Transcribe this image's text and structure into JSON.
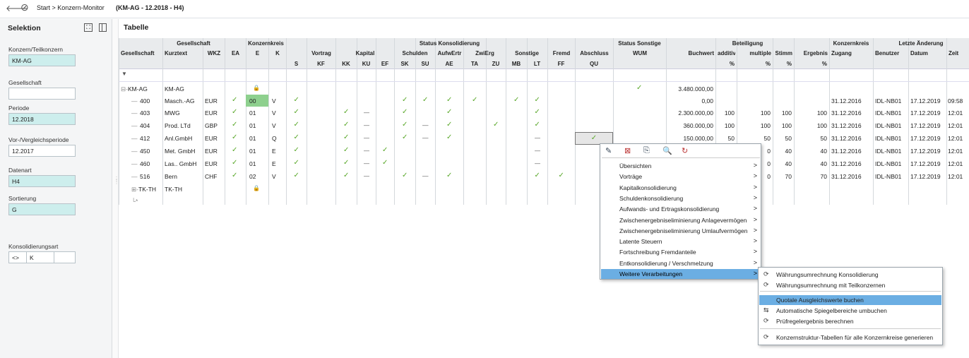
{
  "topbar": {
    "back_icon": "arrow-left-icon",
    "cancel_icon": "no-entry-icon",
    "breadcrumb": "Start > Konzern-Monitor",
    "context": "(KM-AG - 12.2018 - H4)"
  },
  "sidebar": {
    "title": "Selektion",
    "fields": [
      {
        "label": "Konzern/Teilkonzern",
        "value": "KM-AG",
        "teal": true
      },
      {
        "label": "Gesellschaft",
        "value": "",
        "teal": false
      },
      {
        "label": "Periode",
        "value": "12.2018",
        "teal": true
      },
      {
        "label": "Vor-/Vergleichsperiode",
        "value": "12.2017",
        "teal": false
      },
      {
        "label": "Datenart",
        "value": "H4",
        "teal": true
      },
      {
        "label": "Sortierung",
        "value": "G",
        "teal": true
      }
    ],
    "konsart_label": "Konsolidierungsart",
    "konsart_op": "<>",
    "konsart_value": "K"
  },
  "main": {
    "title": "Tabelle"
  },
  "table": {
    "group_headers": [
      "Gesellschaft",
      "Konzernkreis",
      "Status Konsolidierung",
      "Status Sonstige",
      "Beteiligung",
      "Konzernkreis",
      "Letzte Änderung"
    ],
    "row1": [
      "Gesellschaft",
      "Kurztext",
      "WKZ",
      "EA",
      "E",
      "K",
      "Vortrag",
      "Kapital",
      "Schulden",
      "AufwErtr",
      "ZwiErg",
      "Sonstige",
      "Fremd",
      "Abschluss",
      "WUM",
      "Buchwert",
      "additiv",
      "multiple",
      "Stimm",
      "Ergebnis",
      "Zugang",
      "Benutzer",
      "Datum",
      "Zeit"
    ],
    "row2": [
      "S",
      "KF",
      "KK",
      "KU",
      "EF",
      "SK",
      "SU",
      "AE",
      "TA",
      "ZU",
      "MB",
      "LT",
      "FF",
      "QU",
      "%",
      "%",
      "%",
      "%"
    ],
    "rows": [
      {
        "ges": "KM-AG",
        "kurz": "KM-AG",
        "wkz": "",
        "ea": "",
        "e": "",
        "k": "",
        "buchwert": "3.480.000,00",
        "additiv": "",
        "multiple": "",
        "stimm": "",
        "ergebnis": "",
        "zugang": "",
        "benutzer": "",
        "datum": "",
        "zeit": ""
      },
      {
        "ges": "400",
        "kurz": "Masch.-AG",
        "wkz": "EUR",
        "ea": "✓",
        "e": "00",
        "k": "V",
        "buchwert": "0,00",
        "additiv": "",
        "multiple": "",
        "stimm": "",
        "ergebnis": "",
        "zugang": "31.12.2016",
        "benutzer": "IDL-NB01",
        "datum": "17.12.2019",
        "zeit": "09:58"
      },
      {
        "ges": "403",
        "kurz": "MWG",
        "wkz": "EUR",
        "ea": "✓",
        "e": "01",
        "k": "V",
        "buchwert": "2.300.000,00",
        "additiv": "100",
        "multiple": "100",
        "stimm": "100",
        "ergebnis": "100",
        "zugang": "31.12.2016",
        "benutzer": "IDL-NB01",
        "datum": "17.12.2019",
        "zeit": "12:01"
      },
      {
        "ges": "404",
        "kurz": "Prod. LTd",
        "wkz": "GBP",
        "ea": "✓",
        "e": "01",
        "k": "V",
        "buchwert": "360.000,00",
        "additiv": "100",
        "multiple": "100",
        "stimm": "100",
        "ergebnis": "100",
        "zugang": "31.12.2016",
        "benutzer": "IDL-NB01",
        "datum": "17.12.2019",
        "zeit": "12:01"
      },
      {
        "ges": "412",
        "kurz": "Anl.GmbH",
        "wkz": "EUR",
        "ea": "✓",
        "e": "01",
        "k": "Q",
        "buchwert": "150.000,00",
        "additiv": "50",
        "multiple": "50",
        "stimm": "50",
        "ergebnis": "50",
        "zugang": "31.12.2016",
        "benutzer": "IDL-NB01",
        "datum": "17.12.2019",
        "zeit": "12:01"
      },
      {
        "ges": "450",
        "kurz": "Met. GmbH",
        "wkz": "EUR",
        "ea": "✓",
        "e": "01",
        "k": "E",
        "buchwert": "",
        "additiv": "",
        "multiple": "0",
        "stimm": "40",
        "ergebnis": "40",
        "zugang": "31.12.2016",
        "benutzer": "IDL-NB01",
        "datum": "17.12.2019",
        "zeit": "12:01"
      },
      {
        "ges": "460",
        "kurz": "Las.. GmbH",
        "wkz": "EUR",
        "ea": "✓",
        "e": "01",
        "k": "E",
        "buchwert": "",
        "additiv": "",
        "multiple": "0",
        "stimm": "40",
        "ergebnis": "40",
        "zugang": "31.12.2016",
        "benutzer": "IDL-NB01",
        "datum": "17.12.2019",
        "zeit": "12:01"
      },
      {
        "ges": "516",
        "kurz": "Bern",
        "wkz": "CHF",
        "ea": "✓",
        "e": "02",
        "k": "V",
        "buchwert": "",
        "additiv": "",
        "multiple": "0",
        "stimm": "70",
        "ergebnis": "70",
        "zugang": "31.12.2016",
        "benutzer": "IDL-NB01",
        "datum": "17.12.2019",
        "zeit": "12:01"
      },
      {
        "ges": "TK-TH",
        "kurz": "TK-TH",
        "wkz": "",
        "ea": "",
        "e": "",
        "k": "",
        "buchwert": "",
        "additiv": "",
        "multiple": "",
        "stimm": "",
        "ergebnis": "",
        "zugang": "",
        "benutzer": "",
        "datum": "",
        "zeit": ""
      }
    ],
    "filter_icon": "filter-icon",
    "lock_icon": "lock-icon",
    "new_row_marker": "*"
  },
  "context_menu": {
    "toolbar_icons": [
      "edit-icon",
      "delete-doc-icon",
      "copy-icon",
      "preview-icon",
      "refresh-icon"
    ],
    "items": [
      "Übersichten",
      "Vorträge",
      "Kapitalkonsolidierung",
      "Schuldenkonsolidierung",
      "Aufwands- und Ertragskonsolidierung",
      "Zwischenergebniseliminierung Anlagevermögen",
      "Zwischenergebniseliminierung Umlaufvermögen",
      "Latente Steuern",
      "Fortschreibung Fremdanteile",
      "Entkonsolidierung / Verschmelzung",
      "Weitere Verarbeitungen"
    ],
    "arrow": ">"
  },
  "submenu": {
    "items": [
      "Währungsumrechnung Konsolidierung",
      "Währungsumrechnung mit Teilkonzernen",
      "Quotale Ausgleichswerte buchen",
      "Automatische Spiegelbereiche umbuchen",
      "Prüfregelergebnis berechnen",
      "Konzernstruktur-Tabellen für alle Konzernkreise generieren"
    ]
  },
  "colors": {
    "teal": "#cdeeed",
    "yellow_row": "#fffbd6",
    "green_row": "#e6f8dc",
    "check": "#5aa82a",
    "highlight": "#6baee3"
  }
}
